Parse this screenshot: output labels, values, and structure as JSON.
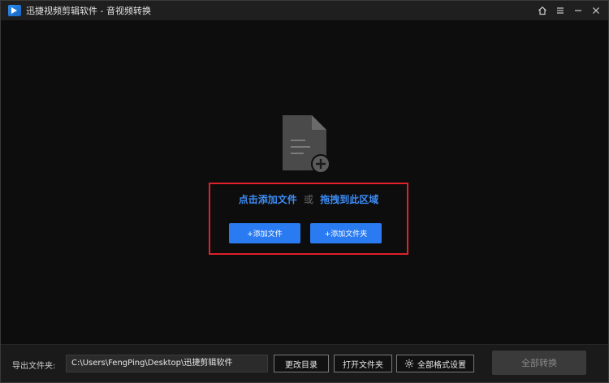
{
  "window": {
    "title": "迅捷视频剪辑软件 - 音视频转换"
  },
  "dropzone": {
    "icon": "file-add-icon",
    "hint_click": "点击添加文件",
    "hint_or": "或",
    "hint_drag": "拖拽到此区域",
    "add_file_label": "+添加文件",
    "add_folder_label": "+添加文件夹",
    "highlight_color": "#e0202a",
    "accent_color": "#2a7bf2"
  },
  "footer": {
    "export_label": "导出文件夹:",
    "export_path": "C:\\Users\\FengPing\\Desktop\\迅捷剪辑软件",
    "change_dir_label": "更改目录",
    "open_folder_label": "打开文件夹",
    "format_settings_label": "全部格式设置",
    "convert_all_label": "全部转换"
  }
}
